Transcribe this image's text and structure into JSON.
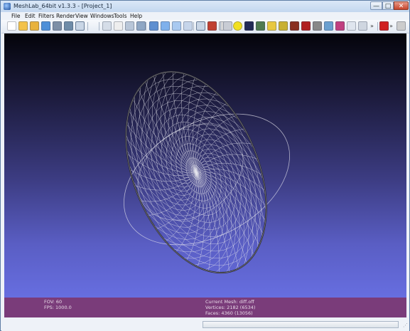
{
  "window": {
    "title": "MeshLab_64bit v1.3.3 - [Project_1]",
    "minimize_glyph": "—",
    "maximize_glyph": "□",
    "close_glyph": "✕"
  },
  "menu": {
    "items": [
      "File",
      "Edit",
      "Filters",
      "Render",
      "View",
      "Windows",
      "Tools",
      "Help"
    ]
  },
  "toolbar": {
    "icons": [
      {
        "name": "new-project-icon",
        "color": "#ffffff"
      },
      {
        "name": "open-project-icon",
        "color": "#f3c24a"
      },
      {
        "name": "open-mesh-icon",
        "color": "#e8b23c"
      },
      {
        "name": "reload-icon",
        "color": "#4d8fd8"
      },
      {
        "name": "export-mesh-icon",
        "color": "#7d8fa6"
      },
      {
        "name": "snapshot-icon",
        "color": "#6f8ca8"
      },
      {
        "name": "layer-dialog-icon",
        "color": "#8a8a8a"
      },
      {
        "name": "bounding-box-icon",
        "color": "#d5dde8"
      },
      {
        "name": "points-icon",
        "color": "#eeeeee"
      },
      {
        "name": "wireframe-icon",
        "color": "#b8c6d8"
      },
      {
        "name": "hidden-lines-icon",
        "color": "#8fa7c4"
      },
      {
        "name": "flat-lines-icon",
        "color": "#5e8fd0"
      },
      {
        "name": "flat-icon",
        "color": "#7fb1ec"
      },
      {
        "name": "smooth-icon",
        "color": "#a9c9f0"
      },
      {
        "name": "texture-icon",
        "color": "#c6d5ea"
      },
      {
        "name": "light-on-off-icon",
        "color": "#f6e35a"
      },
      {
        "name": "double-side-lighting-icon",
        "color": "#c04030"
      },
      {
        "name": "color-per-vertex-icon",
        "color": "#d8d8d8"
      },
      {
        "name": "trackball-icon",
        "color": "#c8ccd4"
      },
      {
        "name": "annotation-icon",
        "color": "#f2e020"
      },
      {
        "name": "info-icon",
        "color": "#222a55"
      },
      {
        "name": "paint-selection-icon",
        "color": "#4f7a4f"
      },
      {
        "name": "measure-tool-icon",
        "color": "#e8c840"
      },
      {
        "name": "align-icon",
        "color": "#c8b030"
      },
      {
        "name": "z-painting-icon",
        "color": "#8a3020"
      },
      {
        "name": "select-vertices-icon",
        "color": "#b02020"
      },
      {
        "name": "select-faces-icon",
        "color": "#888888"
      },
      {
        "name": "select-connected-icon",
        "color": "#6aa0d0"
      },
      {
        "name": "raster-align-icon",
        "color": "#c04080"
      },
      {
        "name": "pickpoints-icon",
        "color": "#dfe5ee"
      },
      {
        "name": "manipulator-icon",
        "color": "#cfd6e0"
      },
      {
        "name": "delete-selection-icon",
        "color": "#d02020"
      },
      {
        "name": "search-icon",
        "color": "#cccccc"
      }
    ],
    "more_glyph": "»"
  },
  "viewport": {
    "mesh_color": "#e6e6ee",
    "background_top": "#04040a",
    "background_bottom": "#676ee0"
  },
  "info": {
    "fov": "FOV: 60",
    "fps": "FPS:  1000.0",
    "current_mesh": "Current Mesh: diff.off",
    "vertices": "Vertices: 2182 (6534)",
    "faces": "Faces: 4360 (13056)"
  }
}
